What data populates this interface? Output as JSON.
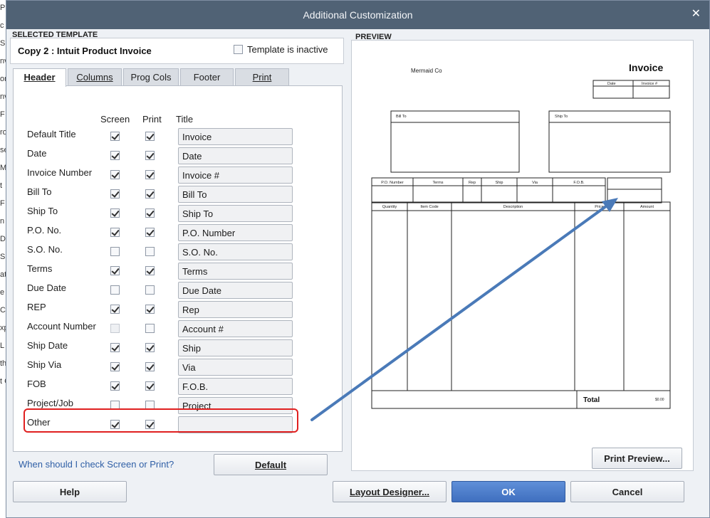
{
  "background_fragments": [
    "Pr",
    "c",
    "S",
    "nv",
    "on",
    "nv",
    "F",
    "ro",
    "se",
    "M",
    "t",
    "F",
    "n",
    "D",
    "S",
    "at",
    "e",
    "C",
    "xp",
    "L",
    "th",
    "t C"
  ],
  "window": {
    "title": "Additional Customization",
    "close_symbol": "✕"
  },
  "selected_template": {
    "section_label": "SELECTED TEMPLATE",
    "name": "Copy 2 : Intuit Product Invoice",
    "inactive_label": "Template is inactive",
    "inactive_checked": false
  },
  "tabs": [
    {
      "label": "Header",
      "active": true
    },
    {
      "label": "Columns",
      "active": false
    },
    {
      "label": "Prog Cols",
      "active": false
    },
    {
      "label": "Footer",
      "active": false
    },
    {
      "label": "Print",
      "active": false
    }
  ],
  "header_columns": {
    "screen": "Screen",
    "print": "Print",
    "title": "Title"
  },
  "fields": [
    {
      "label": "Default Title",
      "screen": true,
      "print": true,
      "title": "Invoice",
      "screen_disabled": false
    },
    {
      "label": "Date",
      "screen": true,
      "print": true,
      "title": "Date",
      "screen_disabled": false
    },
    {
      "label": "Invoice Number",
      "screen": true,
      "print": true,
      "title": "Invoice #",
      "screen_disabled": false
    },
    {
      "label": "Bill To",
      "screen": true,
      "print": true,
      "title": "Bill To",
      "screen_disabled": false
    },
    {
      "label": "Ship To",
      "screen": true,
      "print": true,
      "title": "Ship To",
      "screen_disabled": false
    },
    {
      "label": "P.O. No.",
      "screen": true,
      "print": true,
      "title": "P.O. Number",
      "screen_disabled": false
    },
    {
      "label": "S.O. No.",
      "screen": false,
      "print": false,
      "title": "S.O. No.",
      "screen_disabled": false
    },
    {
      "label": "Terms",
      "screen": true,
      "print": true,
      "title": "Terms",
      "screen_disabled": false
    },
    {
      "label": "Due Date",
      "screen": false,
      "print": false,
      "title": "Due Date",
      "screen_disabled": false
    },
    {
      "label": "REP",
      "screen": true,
      "print": true,
      "title": "Rep",
      "screen_disabled": false
    },
    {
      "label": "Account Number",
      "screen": false,
      "print": false,
      "title": "Account #",
      "screen_disabled": true
    },
    {
      "label": "Ship Date",
      "screen": true,
      "print": true,
      "title": "Ship",
      "screen_disabled": false
    },
    {
      "label": "Ship Via",
      "screen": true,
      "print": true,
      "title": "Via",
      "screen_disabled": false
    },
    {
      "label": "FOB",
      "screen": true,
      "print": true,
      "title": "F.O.B.",
      "screen_disabled": false
    },
    {
      "label": "Project/Job",
      "screen": false,
      "print": false,
      "title": "Project",
      "screen_disabled": false
    },
    {
      "label": "Other",
      "screen": true,
      "print": true,
      "title": "",
      "screen_disabled": false
    }
  ],
  "help_link": "When should I check Screen or Print?",
  "buttons": {
    "default": "Default",
    "print_preview": "Print Preview...",
    "help": "Help",
    "layout_designer": "Layout Designer...",
    "ok": "OK",
    "cancel": "Cancel"
  },
  "preview": {
    "section_label": "PREVIEW",
    "company": "Mermaid Co",
    "invoice_title": "Invoice",
    "date_hdr": "Date",
    "invoice_no_hdr": "Invoice #",
    "bill_to": "Bill To",
    "ship_to": "Ship To",
    "info_headers": [
      "P.O. Number",
      "Terms",
      "Rep",
      "Ship",
      "Via",
      "F.O.B."
    ],
    "line_headers": [
      "Quantity",
      "Item Code",
      "Description",
      "Price",
      "Amount"
    ],
    "total_label": "Total",
    "total_value": "$0.00"
  },
  "colors": {
    "titlebar": "#506275",
    "highlight": "#e02020",
    "arrow": "#4a7ab8",
    "ok_button": "#3f6fbf",
    "link": "#2f5fa6"
  }
}
